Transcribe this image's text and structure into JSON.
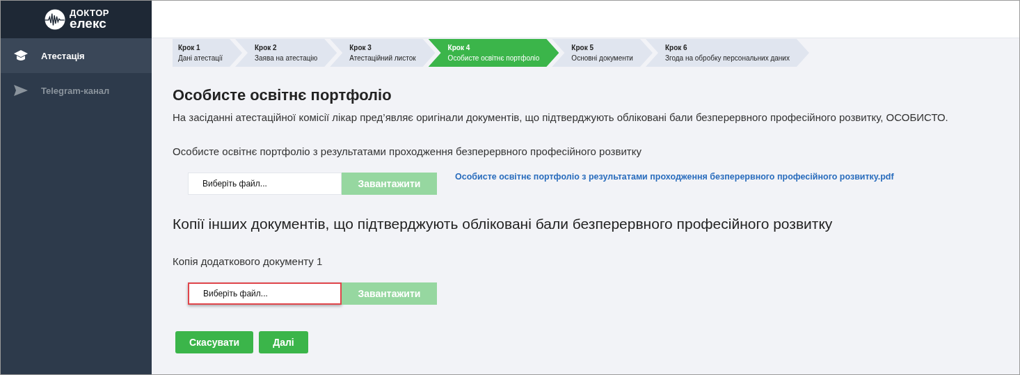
{
  "logo": {
    "line_1": "ДОКТОР",
    "line_2": "елекс"
  },
  "sidebar": {
    "items": [
      {
        "label": "Атестація",
        "kind": "graduation",
        "selected": true
      },
      {
        "label": "Telegram-канал",
        "kind": "send",
        "selected": false
      }
    ]
  },
  "steps": [
    {
      "number": "Крок 1",
      "label": "Дані атестації",
      "selected": false
    },
    {
      "number": "Крок 2",
      "label": "Заява на атестацію",
      "selected": false
    },
    {
      "number": "Крок 3",
      "label": "Атестаційний листок",
      "selected": false
    },
    {
      "number": "Крок 4",
      "label": "Особисте освітнє портфоліо",
      "selected": true
    },
    {
      "number": "Крок 5",
      "label": "Основні документи",
      "selected": false
    },
    {
      "number": "Крок 6",
      "label": "Згода на обробку персональних даних",
      "selected": false
    }
  ],
  "title": "Особисте освітнє портфоліо",
  "notice": "На засіданні атестаційної комісії лікар пред’являє оригінали документів, що підтверджують обліковані бали безперервного професійного розвитку, ОСОБИСТО.",
  "sections": [
    {
      "label": "Особисте освітнє портфоліо з результатами проходження безперервного професійного розвитку",
      "file": {
        "placeholder": "Виберіть файл...",
        "highlighted": false
      },
      "upload": {
        "label": "Завантажити",
        "disabled": true
      },
      "uploaded_link": "Особисте освітнє портфоліо з результатами проходження безперервного професійного розвитку.pdf"
    },
    {
      "heading": "Копії інших документів, що підтверджують обліковані бали безперервного професійного розвитку",
      "label": "Копія додаткового документу 1",
      "file": {
        "placeholder": "Виберіть файл...",
        "highlighted": true
      },
      "upload": {
        "label": "Завантажити",
        "disabled": true
      }
    }
  ],
  "buttons": [
    "Скасувати",
    "Далі"
  ]
}
